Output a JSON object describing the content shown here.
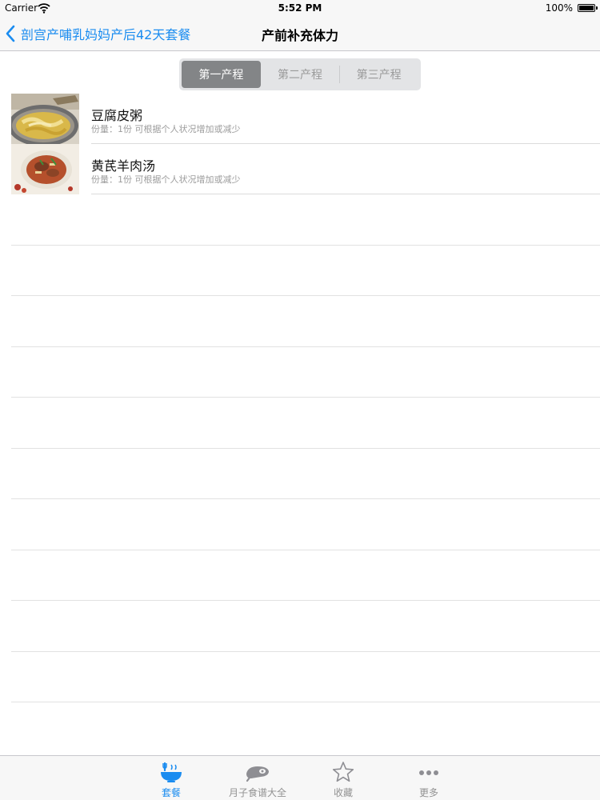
{
  "status_bar": {
    "carrier": "Carrier",
    "time": "5:52 PM",
    "battery": "100%",
    "battery_level": 1.0
  },
  "nav": {
    "back_label": "剖宫产哺乳妈妈产后42天套餐",
    "title": "产前补充体力"
  },
  "segments": [
    {
      "label": "第一产程",
      "selected": true
    },
    {
      "label": "第二产程",
      "selected": false
    },
    {
      "label": "第三产程",
      "selected": false
    }
  ],
  "recipes": [
    {
      "name": "豆腐皮粥",
      "detail": "份量：1份 可根据个人状况增加或减少",
      "thumb_icon": "porridge-photo"
    },
    {
      "name": "黄芪羊肉汤",
      "detail": "份量：1份 可根据个人状况增加或减少",
      "thumb_icon": "mutton-soup-photo"
    }
  ],
  "tabs": [
    {
      "label": "套餐",
      "icon": "bowl-icon",
      "active": true
    },
    {
      "label": "月子食谱大全",
      "icon": "ham-icon",
      "active": false
    },
    {
      "label": "收藏",
      "icon": "star-icon",
      "active": false
    },
    {
      "label": "更多",
      "icon": "more-dots-icon",
      "active": false
    }
  ],
  "colors": {
    "accent": "#1a8cf0",
    "segment_selected": "#838587",
    "bar_background": "#f7f7f7"
  }
}
